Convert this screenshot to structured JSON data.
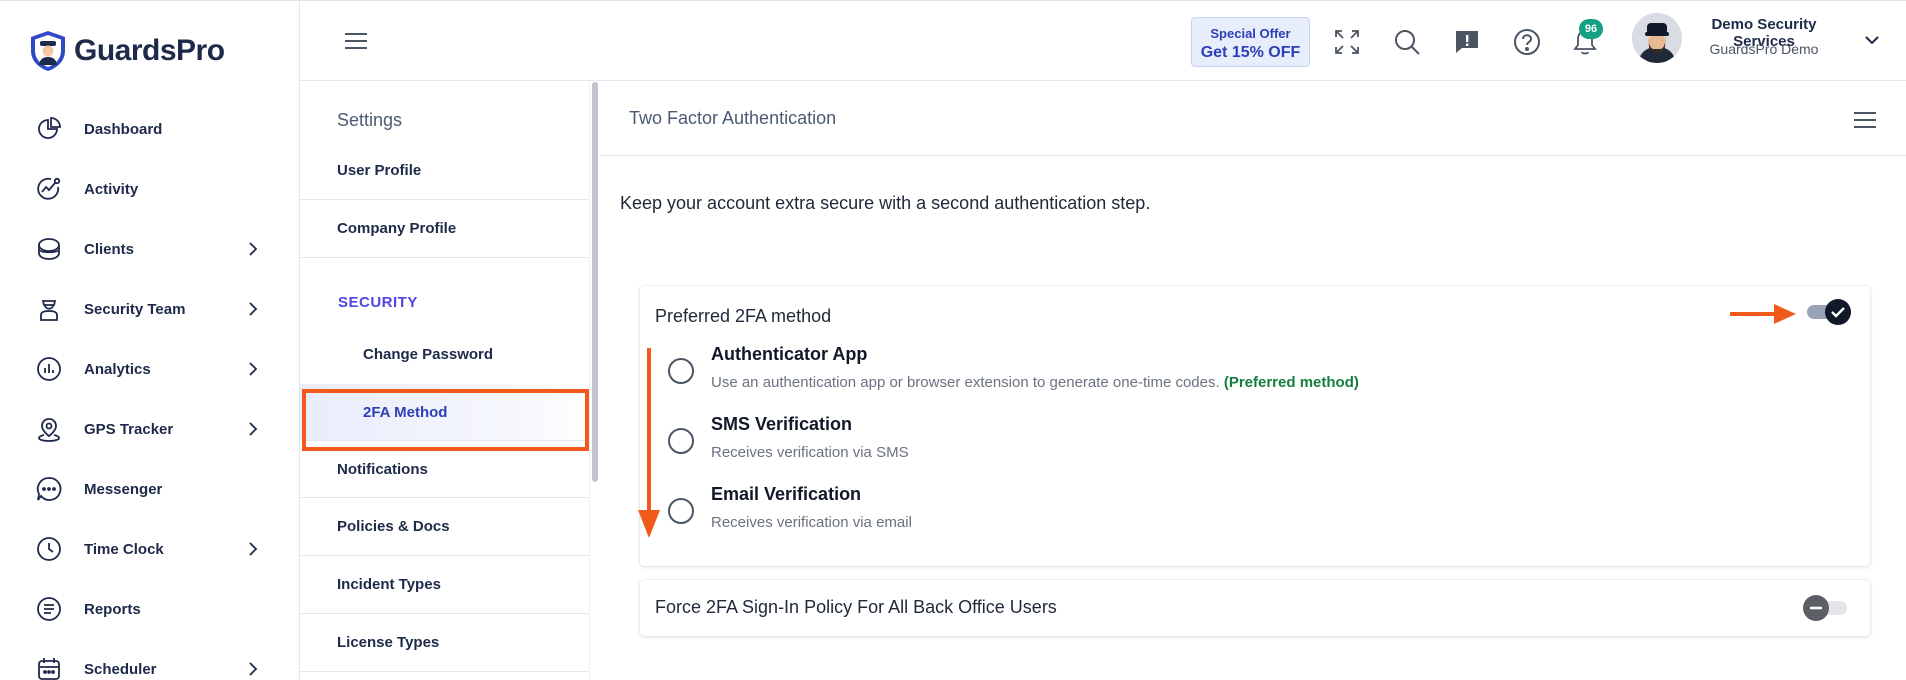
{
  "brand": {
    "name": "GuardsPro"
  },
  "sidebar": {
    "items": [
      {
        "label": "Dashboard",
        "icon": "dashboard-icon",
        "has_children": false
      },
      {
        "label": "Activity",
        "icon": "activity-icon",
        "has_children": false
      },
      {
        "label": "Clients",
        "icon": "clients-icon",
        "has_children": true
      },
      {
        "label": "Security Team",
        "icon": "security-team-icon",
        "has_children": true
      },
      {
        "label": "Analytics",
        "icon": "analytics-icon",
        "has_children": true
      },
      {
        "label": "GPS Tracker",
        "icon": "gps-tracker-icon",
        "has_children": true
      },
      {
        "label": "Messenger",
        "icon": "messenger-icon",
        "has_children": false
      },
      {
        "label": "Time Clock",
        "icon": "time-clock-icon",
        "has_children": true
      },
      {
        "label": "Reports",
        "icon": "reports-icon",
        "has_children": false
      },
      {
        "label": "Scheduler",
        "icon": "scheduler-icon",
        "has_children": true
      }
    ]
  },
  "header": {
    "offer": {
      "line1": "Special Offer",
      "line2": "Get 15% OFF"
    },
    "notification_count": "96",
    "user": {
      "name": "Demo Security Services",
      "company": "GuardsPro Demo"
    }
  },
  "settings": {
    "title": "Settings",
    "items_top": [
      "User Profile",
      "Company Profile"
    ],
    "section": "SECURITY",
    "security_items": [
      "Change Password",
      "2FA Method"
    ],
    "active_item": "2FA Method",
    "items_bottom": [
      "Notifications",
      "Policies & Docs",
      "Incident Types",
      "License Types"
    ]
  },
  "main": {
    "title": "Two Factor Authentication",
    "intro": "Keep your account extra secure with a second authentication step.",
    "preferred": {
      "title": "Preferred 2FA method",
      "enabled": true,
      "options": [
        {
          "title": "Authenticator App",
          "desc": "Use an authentication app or browser extension to generate one-time codes.",
          "tag": "(Preferred method)"
        },
        {
          "title": "SMS Verification",
          "desc": "Receives verification via SMS",
          "tag": ""
        },
        {
          "title": "Email Verification",
          "desc": "Receives verification via email",
          "tag": ""
        }
      ]
    },
    "force_policy": {
      "title": "Force 2FA Sign-In Policy For All Back Office Users",
      "enabled": false
    }
  },
  "colors": {
    "brand": "#1e2a4a",
    "accent": "#2c3fb5",
    "security_section": "#4f46e5",
    "annotation": "#f25a1c",
    "preferred_tag": "#15803d",
    "badge": "#14a085"
  }
}
